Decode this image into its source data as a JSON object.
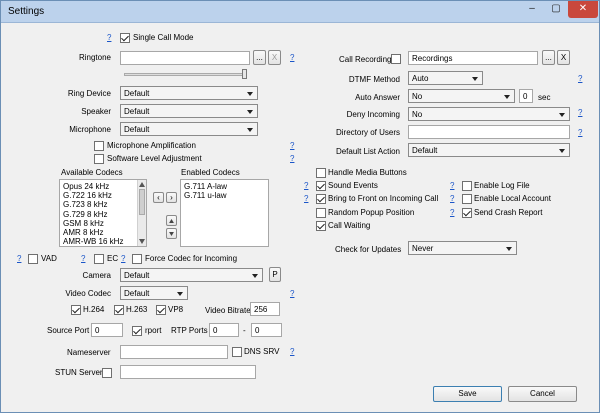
{
  "window": {
    "title": "Settings",
    "minimize": "–",
    "maximize": "▢",
    "close": "✕"
  },
  "help": "?",
  "single_call_mode": {
    "label": "Single Call Mode",
    "checked": true
  },
  "ringtone": {
    "label": "Ringtone",
    "value": "",
    "browse": "...",
    "clear": "X"
  },
  "ring_device": {
    "label": "Ring Device",
    "value": "Default"
  },
  "speaker": {
    "label": "Speaker",
    "value": "Default"
  },
  "microphone": {
    "label": "Microphone",
    "value": "Default"
  },
  "mic_amplification": {
    "label": "Microphone Amplification",
    "checked": false
  },
  "software_level": {
    "label": "Software Level Adjustment",
    "checked": false
  },
  "codecs": {
    "available_label": "Available Codecs",
    "enabled_label": "Enabled Codecs",
    "available": [
      "Opus 24 kHz",
      "G.722 16 kHz",
      "G.723 8 kHz",
      "G.729 8 kHz",
      "GSM 8 kHz",
      "AMR 8 kHz",
      "AMR-WB 16 kHz"
    ],
    "enabled": [
      "G.711 A-law",
      "G.711 u-law"
    ],
    "add": "›",
    "remove": "‹"
  },
  "vad": {
    "label": "VAD",
    "checked": false
  },
  "ec": {
    "label": "EC",
    "checked": false
  },
  "force_codec": {
    "label": "Force Codec for Incoming",
    "checked": false
  },
  "camera": {
    "label": "Camera",
    "value": "Default",
    "button": "P"
  },
  "video_codec": {
    "label": "Video Codec",
    "value": "Default"
  },
  "h264": {
    "label": "H.264",
    "checked": true
  },
  "h263": {
    "label": "H.263",
    "checked": true
  },
  "vp8": {
    "label": "VP8",
    "checked": true
  },
  "video_bitrate": {
    "label": "Video Bitrate",
    "value": "256"
  },
  "source_port": {
    "label": "Source Port",
    "value": "0"
  },
  "rport": {
    "label": "rport",
    "checked": true
  },
  "rtp_ports": {
    "label": "RTP Ports",
    "from": "0",
    "sep": "-",
    "to": "0"
  },
  "nameserver": {
    "label": "Nameserver",
    "value": ""
  },
  "dns_srv": {
    "label": "DNS SRV",
    "checked": false
  },
  "stun_server": {
    "label": "STUN Server",
    "checked": false,
    "value": ""
  },
  "call_recording": {
    "label": "Call Recording",
    "checked": false,
    "value": "Recordings",
    "browse": "...",
    "clear": "X"
  },
  "dtmf_method": {
    "label": "DTMF Method",
    "value": "Auto"
  },
  "auto_answer": {
    "label": "Auto Answer",
    "value": "No",
    "seconds": "0",
    "unit": "sec"
  },
  "deny_incoming": {
    "label": "Deny Incoming",
    "value": "No"
  },
  "directory_of_users": {
    "label": "Directory of Users",
    "value": ""
  },
  "default_list_action": {
    "label": "Default List Action",
    "value": "Default"
  },
  "handle_media_buttons": {
    "label": "Handle Media Buttons",
    "checked": false
  },
  "sound_events": {
    "label": "Sound Events",
    "checked": true
  },
  "bring_to_front": {
    "label": "Bring to Front on Incoming Call",
    "checked": true
  },
  "random_popup": {
    "label": "Random Popup Position",
    "checked": false
  },
  "call_waiting": {
    "label": "Call Waiting",
    "checked": true
  },
  "enable_log_file": {
    "label": "Enable Log File",
    "checked": false
  },
  "enable_local_account": {
    "label": "Enable Local Account",
    "checked": false
  },
  "send_crash_report": {
    "label": "Send Crash Report",
    "checked": true
  },
  "check_for_updates": {
    "label": "Check for Updates",
    "value": "Never"
  },
  "footer": {
    "save": "Save",
    "cancel": "Cancel"
  }
}
